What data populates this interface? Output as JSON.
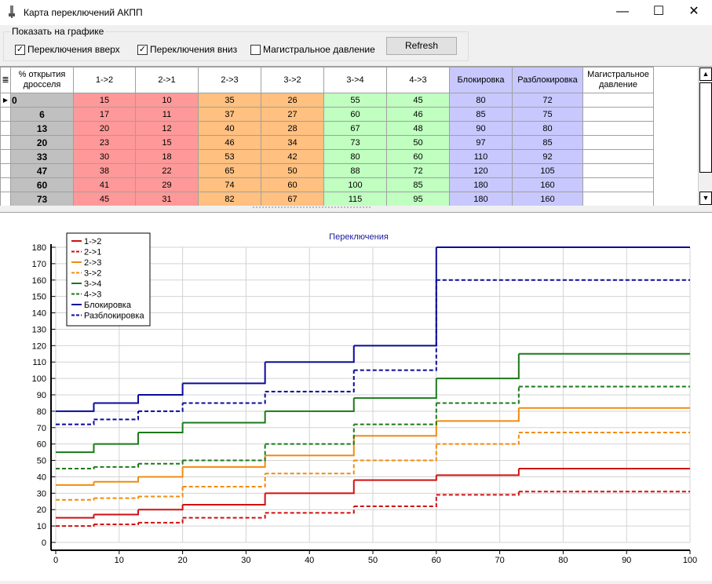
{
  "window": {
    "title": "Карта переключений АКПП",
    "minimize": "—",
    "maximize": "☐",
    "close": "✕"
  },
  "options": {
    "group_label": "Показать на графике",
    "checkboxes": [
      {
        "label": "Переключения вверх",
        "checked": true
      },
      {
        "label": "Переключения вниз",
        "checked": true
      },
      {
        "label": "Магистральное давление",
        "checked": false
      }
    ],
    "refresh_label": "Refresh"
  },
  "table": {
    "columns": [
      "% открытия дросселя",
      "1->2",
      "2->1",
      "2->3",
      "3->2",
      "3->4",
      "4->3",
      "Блокировка",
      "Разблокировка",
      "Магистральное давление"
    ],
    "rows": [
      [
        "0",
        "15",
        "10",
        "35",
        "26",
        "55",
        "45",
        "80",
        "72",
        ""
      ],
      [
        "6",
        "17",
        "11",
        "37",
        "27",
        "60",
        "46",
        "85",
        "75",
        ""
      ],
      [
        "13",
        "20",
        "12",
        "40",
        "28",
        "67",
        "48",
        "90",
        "80",
        ""
      ],
      [
        "20",
        "23",
        "15",
        "46",
        "34",
        "73",
        "50",
        "97",
        "85",
        ""
      ],
      [
        "33",
        "30",
        "18",
        "53",
        "42",
        "80",
        "60",
        "110",
        "92",
        ""
      ],
      [
        "47",
        "38",
        "22",
        "65",
        "50",
        "88",
        "72",
        "120",
        "105",
        ""
      ],
      [
        "60",
        "41",
        "29",
        "74",
        "60",
        "100",
        "85",
        "180",
        "160",
        ""
      ],
      [
        "73",
        "45",
        "31",
        "82",
        "67",
        "115",
        "95",
        "180",
        "160",
        ""
      ]
    ],
    "column_colors": [
      "#c0c0c0",
      "#ff9999",
      "#ff9999",
      "#ffc080",
      "#ffc080",
      "#c0ffc0",
      "#c0ffc0",
      "#c8c8ff",
      "#c8c8ff",
      "#ffffff"
    ]
  },
  "chart_data": {
    "type": "line",
    "step": true,
    "title": "Переключения",
    "x": [
      0,
      6,
      13,
      20,
      33,
      47,
      60,
      73
    ],
    "xlim": [
      0,
      100
    ],
    "ylim": [
      0,
      180
    ],
    "xticks": [
      0,
      10,
      20,
      30,
      40,
      50,
      60,
      70,
      80,
      90,
      100
    ],
    "yticks": [
      0,
      10,
      20,
      30,
      40,
      50,
      60,
      70,
      80,
      90,
      100,
      110,
      120,
      130,
      140,
      150,
      160,
      170,
      180
    ],
    "grid": true,
    "legend": "top-left",
    "series": [
      {
        "name": "1->2",
        "color": "#d01010",
        "dash": false,
        "values": [
          15,
          17,
          20,
          23,
          30,
          38,
          41,
          45
        ]
      },
      {
        "name": "2->1",
        "color": "#d01010",
        "dash": true,
        "values": [
          10,
          11,
          12,
          15,
          18,
          22,
          29,
          31
        ]
      },
      {
        "name": "2->3",
        "color": "#f08c10",
        "dash": false,
        "values": [
          35,
          37,
          40,
          46,
          53,
          65,
          74,
          82
        ]
      },
      {
        "name": "3->2",
        "color": "#f08c10",
        "dash": true,
        "values": [
          26,
          27,
          28,
          34,
          42,
          50,
          60,
          67
        ]
      },
      {
        "name": "3->4",
        "color": "#1a7a1a",
        "dash": false,
        "values": [
          55,
          60,
          67,
          73,
          80,
          88,
          100,
          115
        ]
      },
      {
        "name": "4->3",
        "color": "#1a7a1a",
        "dash": true,
        "values": [
          45,
          46,
          48,
          50,
          60,
          72,
          85,
          95
        ]
      },
      {
        "name": "Блокировка",
        "color": "#0a0a9a",
        "dash": false,
        "values": [
          80,
          85,
          90,
          97,
          110,
          120,
          180,
          180
        ]
      },
      {
        "name": "Разблокировка",
        "color": "#0a0a9a",
        "dash": true,
        "values": [
          72,
          75,
          80,
          85,
          92,
          105,
          160,
          160
        ]
      }
    ]
  }
}
